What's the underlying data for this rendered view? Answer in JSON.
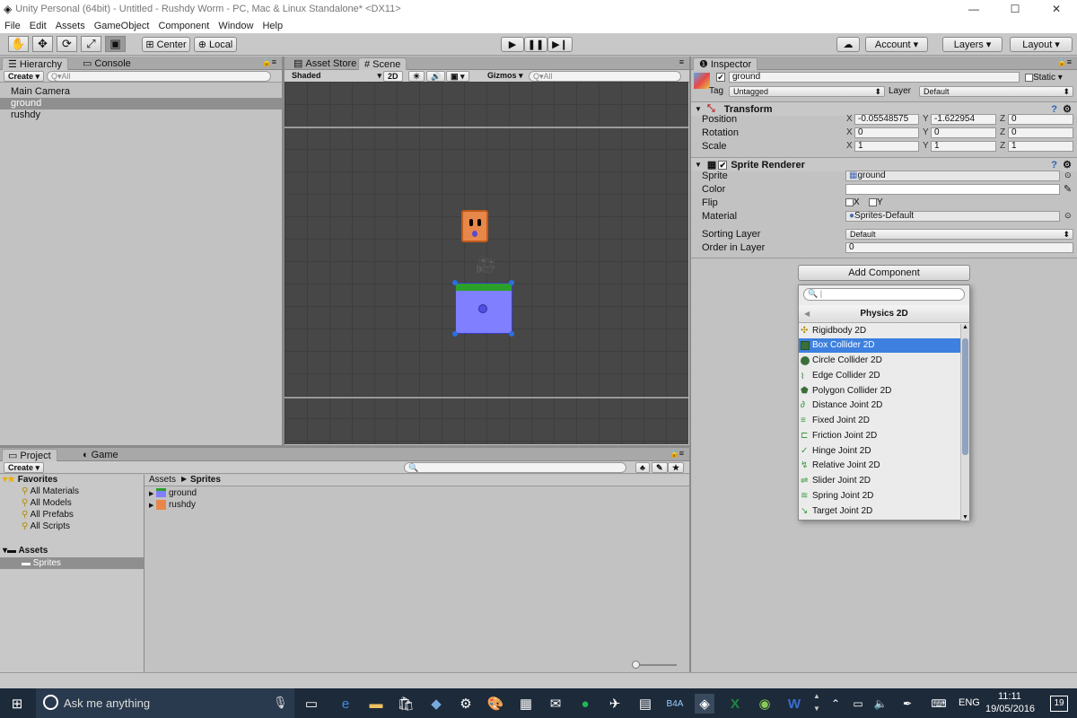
{
  "window": {
    "title": "Unity Personal (64bit) - Untitled - Rushdy Worm - PC, Mac & Linux Standalone* <DX11>",
    "min": "—",
    "max": "☐",
    "close": "✕"
  },
  "menu": [
    "File",
    "Edit",
    "Assets",
    "GameObject",
    "Component",
    "Window",
    "Help"
  ],
  "toolbar": {
    "center": "Center",
    "local": "Local",
    "account": "Account",
    "layers": "Layers",
    "layout": "Layout"
  },
  "hierarchy": {
    "tab": "Hierarchy",
    "tab2": "Console",
    "create": "Create",
    "search": "Q▾All",
    "items": [
      "Main Camera",
      "ground",
      "rushdy"
    ],
    "selected": 1
  },
  "scene": {
    "tab1": "Asset Store",
    "tab2": "Scene",
    "shaded": "Shaded",
    "mode2d": "2D",
    "gizmos": "Gizmos",
    "search": "Q▾All"
  },
  "inspector": {
    "tab": "Inspector",
    "name": "ground",
    "static": "Static",
    "tag_label": "Tag",
    "tag": "Untagged",
    "layer_label": "Layer",
    "layer": "Default",
    "transform": {
      "title": "Transform",
      "rows": [
        {
          "label": "Position",
          "x": "-0.05548575",
          "y": "-1.622954",
          "z": "0"
        },
        {
          "label": "Rotation",
          "x": "0",
          "y": "0",
          "z": "0"
        },
        {
          "label": "Scale",
          "x": "1",
          "y": "1",
          "z": "1"
        }
      ]
    },
    "sprite_renderer": {
      "title": "Sprite Renderer",
      "sprite_label": "Sprite",
      "sprite": "ground",
      "color_label": "Color",
      "flip_label": "Flip",
      "flip_x": "X",
      "flip_y": "Y",
      "material_label": "Material",
      "material": "Sprites-Default",
      "sorting_label": "Sorting Layer",
      "sorting": "Default",
      "order_label": "Order in Layer",
      "order": "0"
    },
    "add_component": "Add Component"
  },
  "popup": {
    "header": "Physics 2D",
    "items": [
      "Rigidbody 2D",
      "Box Collider 2D",
      "Circle Collider 2D",
      "Edge Collider 2D",
      "Polygon Collider 2D",
      "Distance Joint 2D",
      "Fixed Joint 2D",
      "Friction Joint 2D",
      "Hinge Joint 2D",
      "Relative Joint 2D",
      "Slider Joint 2D",
      "Spring Joint 2D",
      "Target Joint 2D"
    ],
    "highlighted": 1
  },
  "project": {
    "tab": "Project",
    "tab2": "Game",
    "create": "Create",
    "favorites": "Favorites",
    "fav_items": [
      "All Materials",
      "All Models",
      "All Prefabs",
      "All Scripts"
    ],
    "assets": "Assets",
    "sprites": "Sprites",
    "breadcrumb_root": "Assets",
    "breadcrumb_leaf": "Sprites",
    "files": [
      "ground",
      "rushdy"
    ]
  },
  "taskbar": {
    "search": "Ask me anything",
    "lang": "ENG",
    "time": "11:11",
    "date": "19/05/2016",
    "notif": "19"
  },
  "colors": {
    "accent": "#3d80df",
    "scene_bg": "#474747",
    "ground_fill": "#7f7fff",
    "ground_top": "#2aa02a"
  }
}
